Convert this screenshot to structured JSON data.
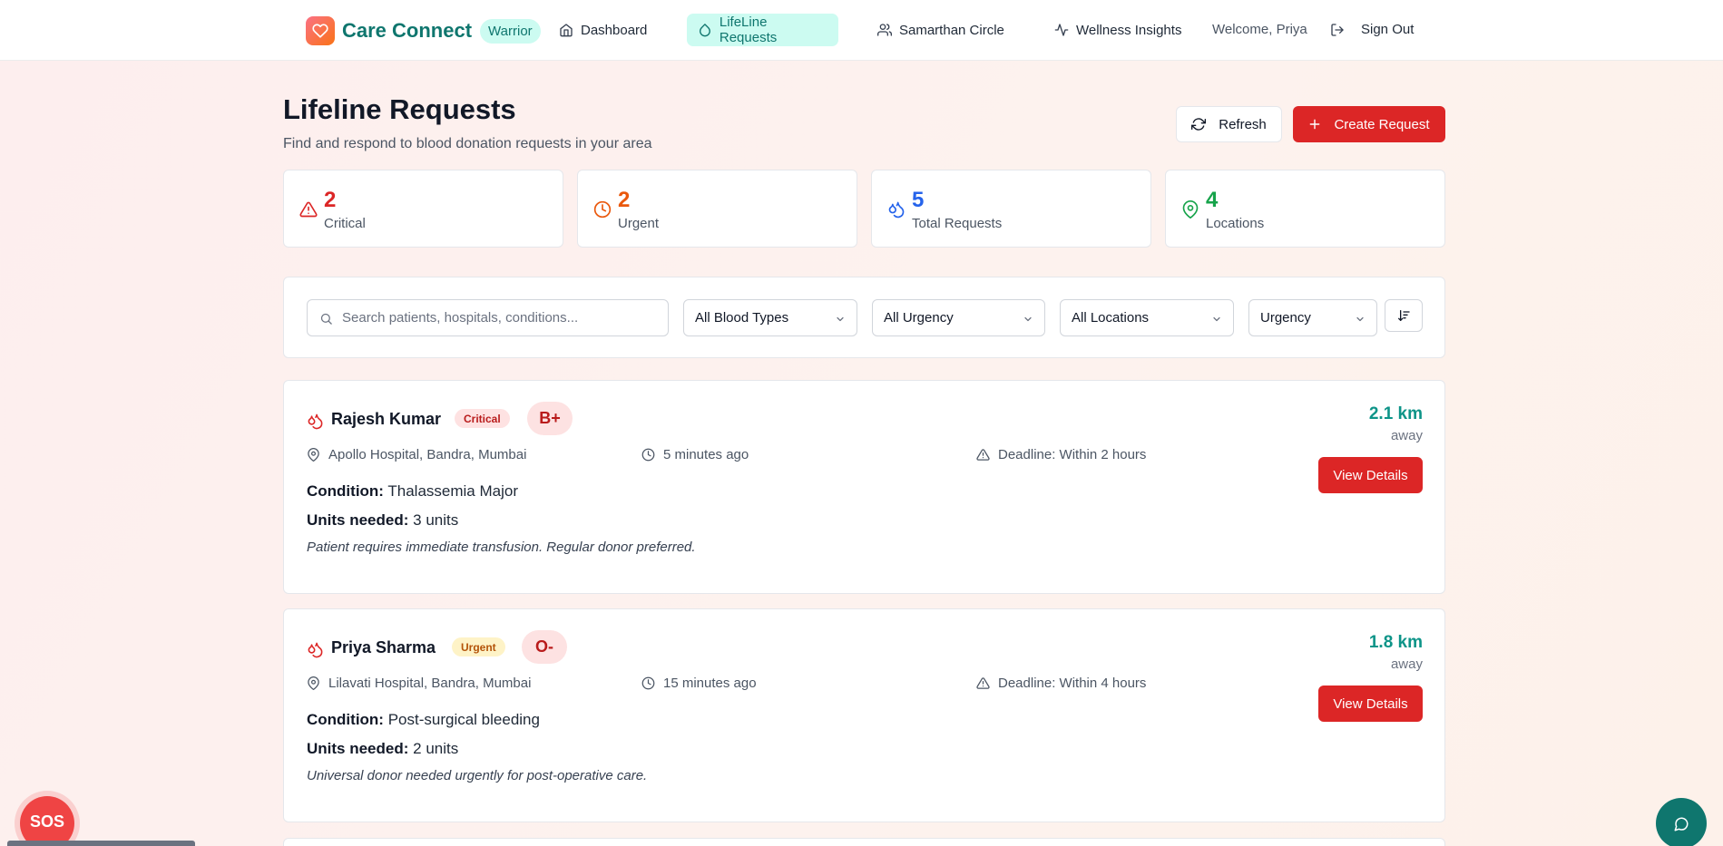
{
  "header": {
    "brand": "Care Connect",
    "badge": "Warrior",
    "nav": [
      {
        "label": "Dashboard",
        "icon": "home-icon"
      },
      {
        "label": "LifeLine Requests",
        "icon": "droplet-icon",
        "active": true
      },
      {
        "label": "Samarthan Circle",
        "icon": "users-icon"
      },
      {
        "label": "Wellness Insights",
        "icon": "activity-icon"
      }
    ],
    "welcome": "Welcome, Priya",
    "sign_out": "Sign Out"
  },
  "page": {
    "title": "Lifeline Requests",
    "subtitle": "Find and respond to blood donation requests in your area",
    "refresh_label": "Refresh",
    "create_label": "Create Request"
  },
  "stats": [
    {
      "value": "2",
      "label": "Critical",
      "color": "#dc2626",
      "icon": "alert-triangle-icon"
    },
    {
      "value": "2",
      "label": "Urgent",
      "color": "#ea580c",
      "icon": "clock-icon"
    },
    {
      "value": "5",
      "label": "Total Requests",
      "color": "#2563eb",
      "icon": "droplets-icon"
    },
    {
      "value": "4",
      "label": "Locations",
      "color": "#16a34a",
      "icon": "map-pin-icon"
    }
  ],
  "filters": {
    "search_placeholder": "Search patients, hospitals, conditions...",
    "blood_type": "All Blood Types",
    "urgency": "All Urgency",
    "location": "All Locations",
    "sort_by": "Urgency"
  },
  "labels": {
    "condition": "Condition:",
    "units_needed": "Units needed:",
    "away": "away",
    "view_details": "View Details"
  },
  "requests": [
    {
      "name": "Rajesh Kumar",
      "urgency": "Critical",
      "blood_type": "B+",
      "hospital": "Apollo Hospital, Bandra, Mumbai",
      "time": "5 minutes ago",
      "deadline": "Deadline: Within 2 hours",
      "condition": "Thalassemia Major",
      "units": "3 units",
      "note": "Patient requires immediate transfusion. Regular donor preferred.",
      "distance": "2.1 km"
    },
    {
      "name": "Priya Sharma",
      "urgency": "Urgent",
      "blood_type": "O-",
      "hospital": "Lilavati Hospital, Bandra, Mumbai",
      "time": "15 minutes ago",
      "deadline": "Deadline: Within 4 hours",
      "condition": "Post-surgical bleeding",
      "units": "2 units",
      "note": "Universal donor needed urgently for post-operative care.",
      "distance": "1.8 km"
    }
  ],
  "floating": {
    "sos": "SOS",
    "chat_icon": "message-circle-icon"
  },
  "colors": {
    "primary_red": "#dc2626",
    "teal": "#0f766e",
    "critical_badge_bg": "#fee2e2",
    "urgent_badge_bg": "#fef3c7"
  }
}
